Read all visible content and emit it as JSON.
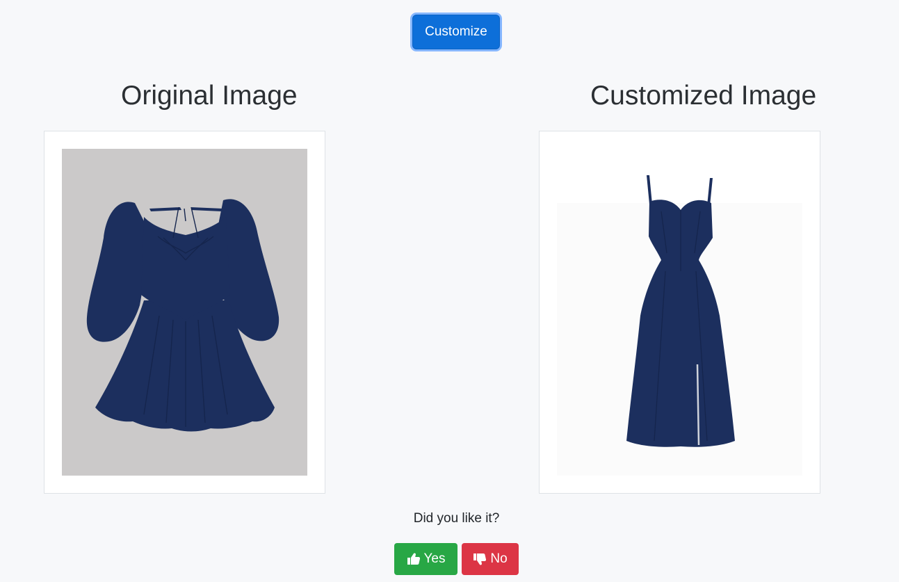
{
  "toolbar": {
    "customize_label": "Customize"
  },
  "original": {
    "heading": "Original Image"
  },
  "customized": {
    "heading": "Customized Image"
  },
  "feedback": {
    "question": "Did you like it?",
    "yes_label": "Yes",
    "no_label": "No",
    "yes_icon": "thumbs-up-icon",
    "no_icon": "thumbs-down-icon"
  },
  "colors": {
    "primary": "#0d6fd9",
    "success": "#28a745",
    "danger": "#dc3545",
    "dress": "#1c2f5e",
    "page_background": "#f7f8fa"
  }
}
